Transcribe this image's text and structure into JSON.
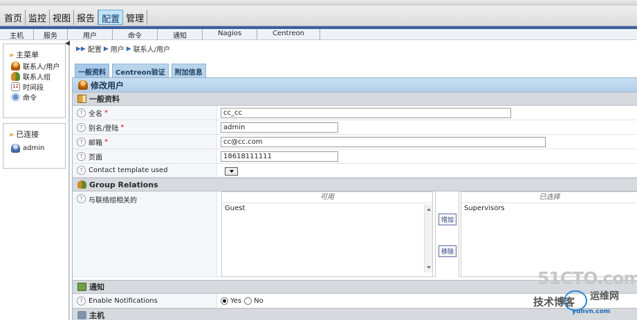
{
  "top_menu": [
    "首页",
    "监控",
    "视图",
    "报告",
    "配置",
    "管理"
  ],
  "active_top": "配置",
  "sub_menu": [
    "主机",
    "服务",
    "用户",
    "命令",
    "通知",
    "Nagios",
    "Centreon"
  ],
  "sidebar": {
    "main_title": "主菜单",
    "items": [
      {
        "label": "联系人/用户",
        "icon": "user-icon"
      },
      {
        "label": "联系人组",
        "icon": "group-icon"
      },
      {
        "label": "时间段",
        "icon": "calendar-icon"
      },
      {
        "label": "命令",
        "icon": "command-icon"
      }
    ],
    "connected_title": "已连接",
    "connected_user": "admin"
  },
  "breadcrumb": [
    "配置",
    "用户",
    "联系人/用户"
  ],
  "tabs": [
    "一般资料",
    "Centreon验证",
    "附加信息"
  ],
  "form": {
    "title": "修改用户",
    "section_general": "一般资料",
    "fields": {
      "fullname": {
        "label": "全名",
        "value": "cc_cc"
      },
      "alias": {
        "label": "别名/登陆",
        "value": "admin"
      },
      "email": {
        "label": "邮箱",
        "value": "cc@cc.com"
      },
      "pager": {
        "label": "页面",
        "value": "18618111111"
      },
      "template": {
        "label": "Contact template used"
      }
    },
    "required_mark": "*",
    "section_group": "Group Relations",
    "group_label": "与联络组相关的",
    "available_header": "可用",
    "available_items": [
      "Guest"
    ],
    "selected_header": "已选择",
    "selected_items": [
      "Supervisors"
    ],
    "add_button": "增加",
    "remove_button": "移除",
    "section_notify": "通知",
    "notify_label": "Enable Notifications",
    "notify_yes": "Yes",
    "notify_no": "No",
    "notify_value": "Yes",
    "section_next": "主机"
  },
  "help_glyph": "?",
  "watermark": {
    "line1": "51CTO.com",
    "line2": "技术博客",
    "line3": "运维网",
    "line4": "yunvn.com"
  }
}
